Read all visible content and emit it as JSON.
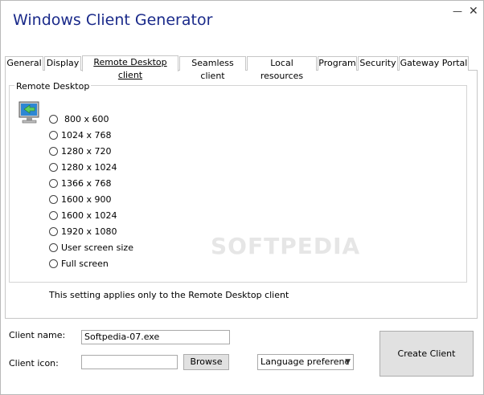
{
  "window": {
    "title": "Windows Client Generator",
    "min_glyph": "—",
    "close_glyph": "✕"
  },
  "tabs": [
    {
      "label": "General"
    },
    {
      "label": "Display"
    },
    {
      "label": "Remote Desktop client"
    },
    {
      "label": "Seamless client"
    },
    {
      "label": "Local resources"
    },
    {
      "label": "Program"
    },
    {
      "label": "Security"
    },
    {
      "label": "Gateway Portal"
    }
  ],
  "active_tab": "Remote Desktop client",
  "group": {
    "label": "Remote Desktop",
    "icon": "rdp-monitor-icon",
    "options": [
      {
        "label": "800 x 600",
        "selected": false
      },
      {
        "label": "1024 x 768",
        "selected": false
      },
      {
        "label": "1280 x 720",
        "selected": false
      },
      {
        "label": "1280 x 1024",
        "selected": false
      },
      {
        "label": "1366 x 768",
        "selected": false
      },
      {
        "label": "1600 x 900",
        "selected": false
      },
      {
        "label": "1600 x 1024",
        "selected": false
      },
      {
        "label": "1920 x 1080",
        "selected": false
      },
      {
        "label": "User screen size",
        "selected": false
      },
      {
        "label": "Full screen",
        "selected": false
      }
    ]
  },
  "note": "This setting applies only to the Remote Desktop client",
  "client": {
    "name_label": "Client name:",
    "name_value": "Softpedia-07.exe",
    "icon_label": "Client icon:",
    "icon_value": "",
    "browse_label": "Browse",
    "language_value": "Language preferenc",
    "create_label": "Create Client"
  },
  "watermark": "SOFTPEDIA",
  "colors": {
    "title": "#1a2a8a",
    "border": "#c6c6c6",
    "button_bg": "#e1e1e1"
  }
}
